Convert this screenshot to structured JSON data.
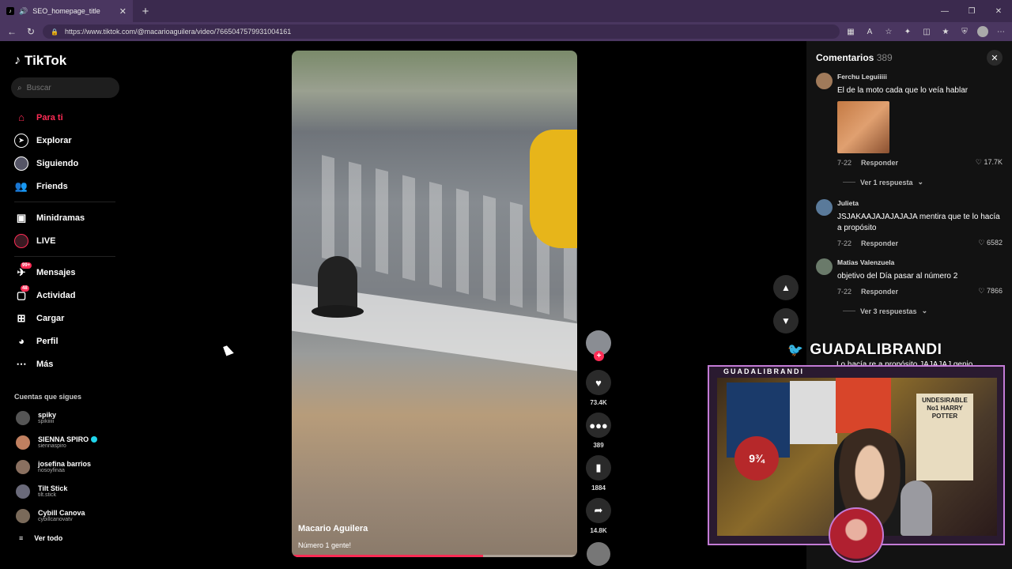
{
  "browser": {
    "tab_title": "SEO_homepage_title",
    "url": "https://www.tiktok.com/@macarioaguilera/video/7665047579931004161"
  },
  "sidebar": {
    "logo": "TikTok",
    "search_placeholder": "Buscar",
    "nav": [
      {
        "label": "Para ti",
        "icon": "home-icon"
      },
      {
        "label": "Explorar",
        "icon": "compass-icon"
      },
      {
        "label": "Siguiendo",
        "icon": "following-icon"
      },
      {
        "label": "Friends",
        "icon": "friends-icon"
      },
      {
        "label": "Minidramas",
        "icon": "minidramas-icon"
      },
      {
        "label": "LIVE",
        "icon": "live-icon"
      },
      {
        "label": "Mensajes",
        "icon": "messages-icon",
        "badge": "99+"
      },
      {
        "label": "Actividad",
        "icon": "activity-icon",
        "badge": "48"
      },
      {
        "label": "Cargar",
        "icon": "upload-icon"
      },
      {
        "label": "Perfil",
        "icon": "profile-icon"
      },
      {
        "label": "Más",
        "icon": "more-icon"
      }
    ],
    "following_title": "Cuentas que sigues",
    "following": [
      {
        "name": "spiky",
        "username": "spikiiiii"
      },
      {
        "name": "SIENNA SPIRO",
        "username": "siennaspiro",
        "verified": true
      },
      {
        "name": "josefina barrios",
        "username": "nosoyfinaa"
      },
      {
        "name": "Tilt Stick",
        "username": "tilt.stick"
      },
      {
        "name": "Cybill Canova",
        "username": "cybillcanovatv"
      }
    ],
    "see_all": "Ver todo"
  },
  "video": {
    "author": "Macario Aguilera",
    "description": "Número 1 gente!"
  },
  "actions": {
    "likes": "73.4K",
    "comments": "389",
    "saves": "1884",
    "shares": "14.8K"
  },
  "comments": {
    "title": "Comentarios",
    "count": "389",
    "items": [
      {
        "user": "Ferchu Leguiiiii",
        "text": "El de la moto cada que lo veía hablar",
        "date": "7-22",
        "reply": "Responder",
        "likes": "17.7K",
        "replies_label": "Ver 1 respuesta"
      },
      {
        "user": "Julieta",
        "text": "JSJAKAAJAJAJAJAJA mentira que te lo hacía a propósito",
        "date": "7-22",
        "reply": "Responder",
        "likes": "6582"
      },
      {
        "user": "Matias Valenzuela",
        "text": "objetivo del Día pasar al número 2",
        "date": "7-22",
        "reply": "Responder",
        "likes": "7866",
        "replies_label": "Ver 3 respuestas"
      }
    ]
  },
  "stream_overlay": {
    "twitter_handle": "GUADALIBRANDI",
    "cam_label": "GUADALIBRANDI",
    "partial_comment": "Lo hacía re a propósito JAJAJAJ genio",
    "poster_text": "UNDESIRABLE No1 HARRY POTTER",
    "platform_text": "9¾"
  },
  "progress": 0.67
}
